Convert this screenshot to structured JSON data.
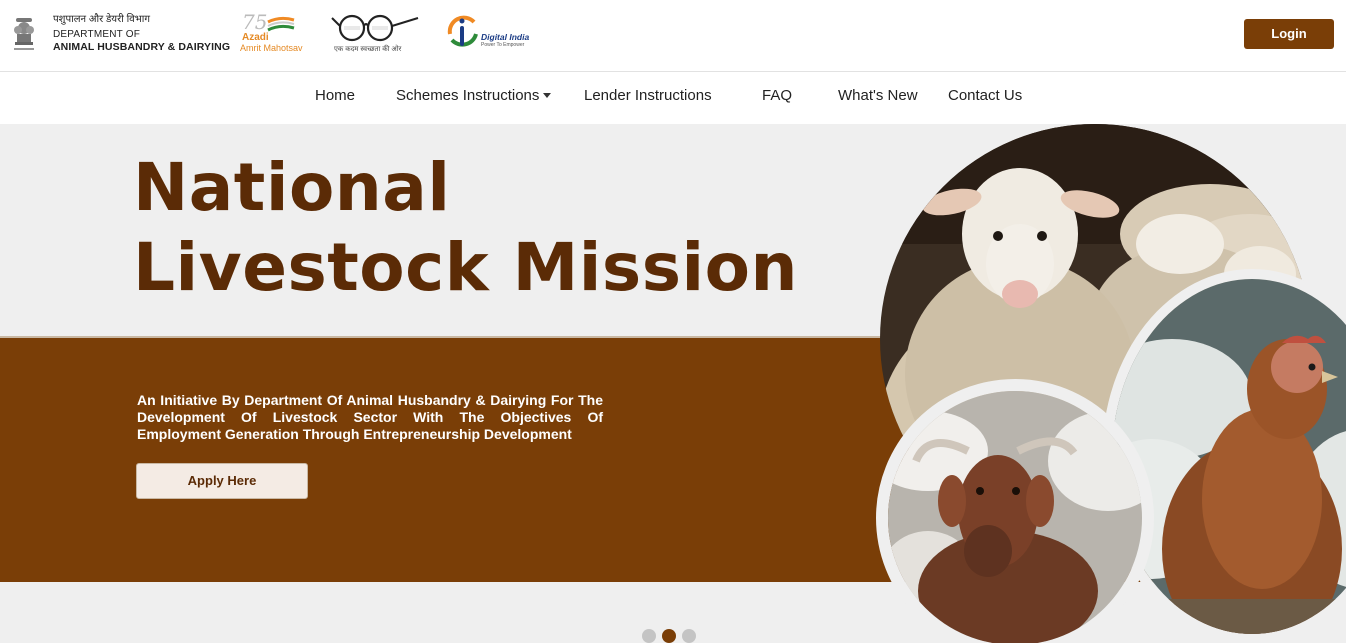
{
  "header": {
    "dept_hindi": "पशुपालन और डेयरी विभाग",
    "dept_line1": "DEPARTMENT OF",
    "dept_line2": "ANIMAL HUSBANDRY & DAIRYING",
    "azadi_number": "75",
    "azadi_word1": "Azadi",
    "azadi_word2": "Amrit Mahotsav",
    "swachh_tagline": "एक कदम स्वच्छता की ओर",
    "digital_india": "Digital India",
    "digital_india_tagline": "Power To Empower",
    "login_label": "Login"
  },
  "nav": {
    "items": [
      {
        "label": "Home"
      },
      {
        "label": "Schemes Instructions",
        "has_dropdown": true
      },
      {
        "label": "Lender Instructions"
      },
      {
        "label": "FAQ"
      },
      {
        "label": "What's New"
      },
      {
        "label": "Contact Us"
      }
    ]
  },
  "hero": {
    "title_line1": "National",
    "title_line2": "Livestock Mission",
    "description": "An Initiative By Department Of Animal Husbandry & Dairying For The Development Of Livestock Sector With The Objectives Of Employment Generation Through Entrepreneurship Development",
    "apply_label": "Apply Here",
    "carousel": {
      "total": 3,
      "active_index": 1
    }
  },
  "colors": {
    "brand_brown": "#7a3e07",
    "title_brown": "#5b2b06",
    "hero_bg": "#efefef",
    "dot_active": "#7a3e07",
    "dot_inactive": "#c4c4c4"
  }
}
